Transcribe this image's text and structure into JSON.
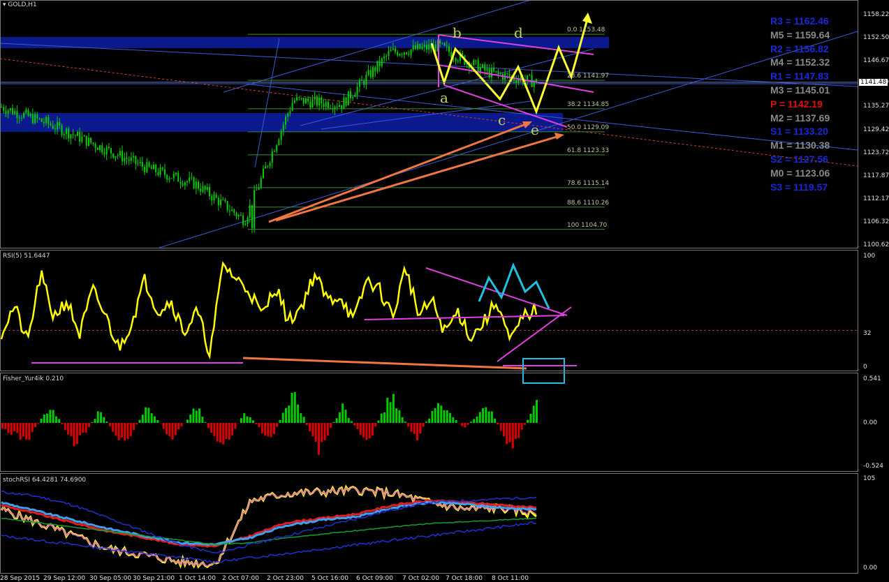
{
  "symbol_title": "GOLD,H1",
  "rsi_title": "RSI(5) 51.6447",
  "fisher_title": "Fisher_Yur4ik 0.210",
  "stoch_title": "stochRSI 64.4281 74.6900",
  "current_price": "1141.48",
  "price_axis": [
    "1158.22",
    "1152.50",
    "1146.67",
    "1140.97",
    "1135.27",
    "1129.42",
    "1123.72",
    "1117.87",
    "1112.17",
    "1106.32",
    "1100.62"
  ],
  "rsi_axis": [
    "100",
    "32",
    "0"
  ],
  "fisher_axis": [
    "0.541",
    "0.00",
    "-0.524"
  ],
  "stoch_axis": [
    "105",
    "0.00"
  ],
  "date_axis": [
    "28 Sep 2015",
    "29 Sep 12:00",
    "30 Sep 05:00",
    "30 Sep 21:00",
    "1 Oct 14:00",
    "2 Oct 07:00",
    "2 Oct 23:00",
    "5 Oct 16:00",
    "6 Oct 09:00",
    "7 Oct 02:00",
    "7 Oct 18:00",
    "8 Oct 11:00"
  ],
  "pivots": [
    {
      "label": "R3 = 1162.46",
      "color": "#1a28d8"
    },
    {
      "label": "M5 = 1159.64",
      "color": "#8a8a8a"
    },
    {
      "label": "R2 = 1156.82",
      "color": "#1a28d8"
    },
    {
      "label": "M4 = 1152.32",
      "color": "#8a8a8a"
    },
    {
      "label": "R1 = 1147.83",
      "color": "#1a28d8"
    },
    {
      "label": "M3 = 1145.01",
      "color": "#8a8a8a"
    },
    {
      "label": "P   = 1142.19",
      "color": "#e01010"
    },
    {
      "label": "M2 = 1137.69",
      "color": "#8a8a8a"
    },
    {
      "label": "S1 = 1133.20",
      "color": "#1a28d8"
    },
    {
      "label": "M1 = 1130.38",
      "color": "#8a8a8a"
    },
    {
      "label": "S2 = 1127.56",
      "color": "#1a28d8"
    },
    {
      "label": "M0 = 1123.06",
      "color": "#8a8a8a"
    },
    {
      "label": "S3 = 1119.57",
      "color": "#1a28d8"
    }
  ],
  "fib_levels": [
    {
      "label": "0.0 1153.48",
      "price": 1153.48
    },
    {
      "label": "23.6 1141.97",
      "price": 1141.97
    },
    {
      "label": "38.2 1134.85",
      "price": 1134.85
    },
    {
      "label": "50.0 1129.09",
      "price": 1129.09
    },
    {
      "label": "61.8 1123.33",
      "price": 1123.33
    },
    {
      "label": "78.6 1115.14",
      "price": 1115.14
    },
    {
      "label": "88.6 1110.26",
      "price": 1110.26
    },
    {
      "label": "100 1104.70",
      "price": 1104.7
    }
  ],
  "wave_labels": [
    "a",
    "b",
    "c",
    "d",
    "e"
  ],
  "colors": {
    "candle": "#00d000",
    "rsi": "#ffff00",
    "fisher_pos": "#00cc00",
    "fisher_neg": "#dd0000",
    "zone": "#0a1a8c",
    "trend": "#3a5ad8",
    "channel": "#e040e0",
    "arrow_orange": "#f07840",
    "arrow_yellow": "#ffff30",
    "arrow_cyan": "#20c0e0"
  },
  "chart_data": {
    "type": "candlestick",
    "symbol": "GOLD",
    "timeframe": "H1",
    "approx_close_path": {
      "x": [
        "28 Sep 2015",
        "29 Sep 12:00",
        "30 Sep 05:00",
        "30 Sep 21:00",
        "1 Oct 14:00",
        "2 Oct 07:00",
        "2 Oct 23:00",
        "5 Oct 16:00",
        "6 Oct 09:00",
        "7 Oct 02:00",
        "7 Oct 18:00",
        "8 Oct 11:00"
      ],
      "y": [
        1135.3,
        1131.0,
        1125.5,
        1120.0,
        1116.0,
        1107.0,
        1137.0,
        1136.0,
        1149.0,
        1150.5,
        1144.0,
        1141.5
      ]
    },
    "last_price": 1141.48,
    "ylim": [
      1100.62,
      1158.22
    ],
    "indicators": {
      "rsi_period": 5,
      "rsi_last": 51.6447,
      "fisher_last": 0.21,
      "stoch_rsi": [
        64.4281,
        74.69
      ]
    }
  }
}
